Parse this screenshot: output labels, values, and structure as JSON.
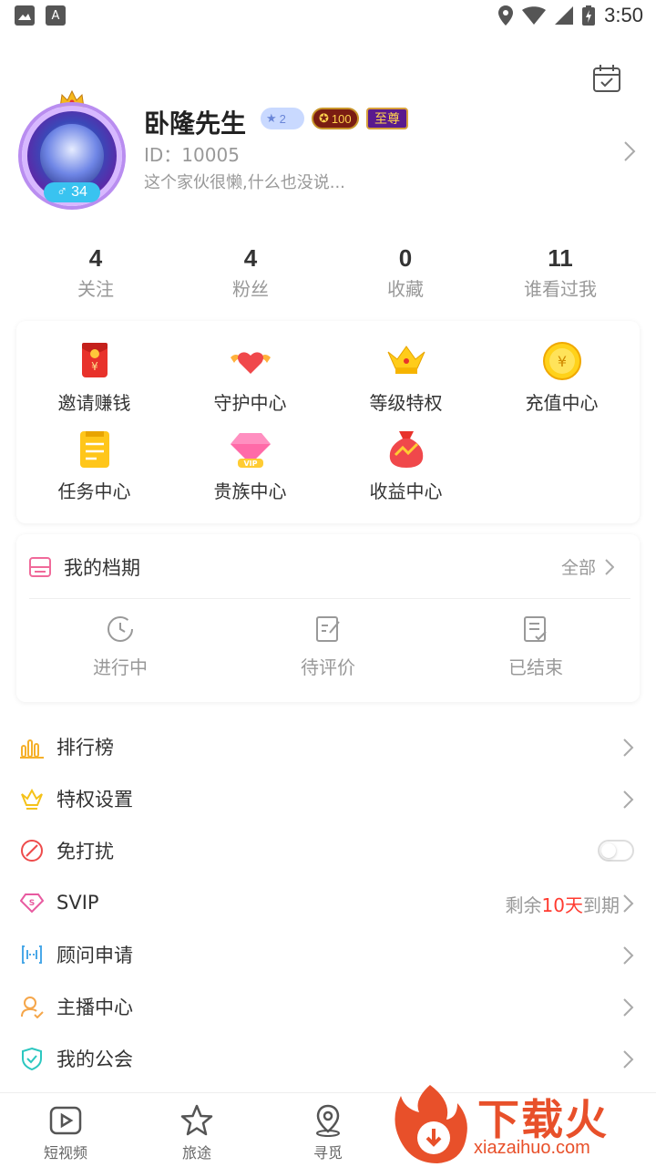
{
  "status_bar": {
    "time": "3:50"
  },
  "profile": {
    "name": "卧隆先生",
    "id_text": "ID：10005",
    "bio": "这个家伙很懒,什么也没说...",
    "gender_age": "34",
    "badge_star_level": "2",
    "badge_level": "100",
    "badge_vip": "至尊"
  },
  "stats": [
    {
      "value": "4",
      "label": "关注"
    },
    {
      "value": "4",
      "label": "粉丝"
    },
    {
      "value": "0",
      "label": "收藏"
    },
    {
      "value": "11",
      "label": "谁看过我"
    }
  ],
  "features": [
    {
      "label": "邀请赚钱",
      "icon": "red-envelope-icon"
    },
    {
      "label": "守护中心",
      "icon": "winged-heart-icon"
    },
    {
      "label": "等级特权",
      "icon": "crown-icon"
    },
    {
      "label": "充值中心",
      "icon": "coin-icon"
    },
    {
      "label": "任务中心",
      "icon": "task-list-icon"
    },
    {
      "label": "贵族中心",
      "icon": "vip-diamond-icon"
    },
    {
      "label": "收益中心",
      "icon": "money-bag-icon"
    }
  ],
  "schedule": {
    "title": "我的档期",
    "all_label": "全部",
    "items": [
      {
        "label": "进行中",
        "icon": "clock-icon"
      },
      {
        "label": "待评价",
        "icon": "edit-note-icon"
      },
      {
        "label": "已结束",
        "icon": "done-note-icon"
      }
    ]
  },
  "menu": [
    {
      "label": "排行榜",
      "icon": "ranking-icon"
    },
    {
      "label": "特权设置",
      "icon": "crown-outline-icon"
    },
    {
      "label": "免打扰",
      "icon": "do-not-disturb-icon",
      "toggle_on": false
    },
    {
      "label": "SVIP",
      "icon": "svip-diamond-icon",
      "extra_prefix": "剩余",
      "extra_highlight": "10天",
      "extra_suffix": "到期"
    },
    {
      "label": "顾问申请",
      "icon": "consultant-icon"
    },
    {
      "label": "主播中心",
      "icon": "anchor-user-icon"
    },
    {
      "label": "我的公会",
      "icon": "guild-shield-icon"
    }
  ],
  "bottom_nav": [
    {
      "label": "短视频",
      "icon": "video-icon"
    },
    {
      "label": "旅途",
      "icon": "star-icon"
    },
    {
      "label": "寻觅",
      "icon": "location-icon"
    }
  ],
  "watermark": {
    "text": "下载火",
    "sub": "xiazaihuo.com"
  },
  "colors": {
    "accent": "#e8502a",
    "highlight": "#ff3b30",
    "gender": "#39c3f0"
  }
}
